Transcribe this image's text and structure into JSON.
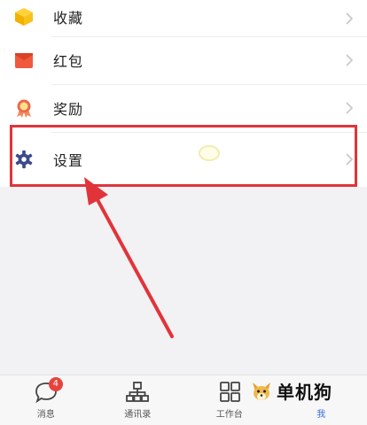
{
  "menu": {
    "items": [
      {
        "label": "收藏",
        "icon": "favorites-cube-icon"
      },
      {
        "label": "红包",
        "icon": "red-envelope-icon"
      },
      {
        "label": "奖励",
        "icon": "award-medal-icon"
      },
      {
        "label": "设置",
        "icon": "gear-icon"
      }
    ]
  },
  "tabbar": {
    "tabs": [
      {
        "label": "消息",
        "icon": "chat-bubble-icon",
        "badge": "4"
      },
      {
        "label": "通讯录",
        "icon": "org-chart-icon"
      },
      {
        "label": "工作台",
        "icon": "grid-apps-icon"
      },
      {
        "label": "我",
        "icon": "profile-icon",
        "active": true
      }
    ]
  },
  "watermark": {
    "text": "单机狗"
  },
  "colors": {
    "accent": "#3a6fe0",
    "highlight": "#e1343a",
    "badge": "#e8423d"
  }
}
